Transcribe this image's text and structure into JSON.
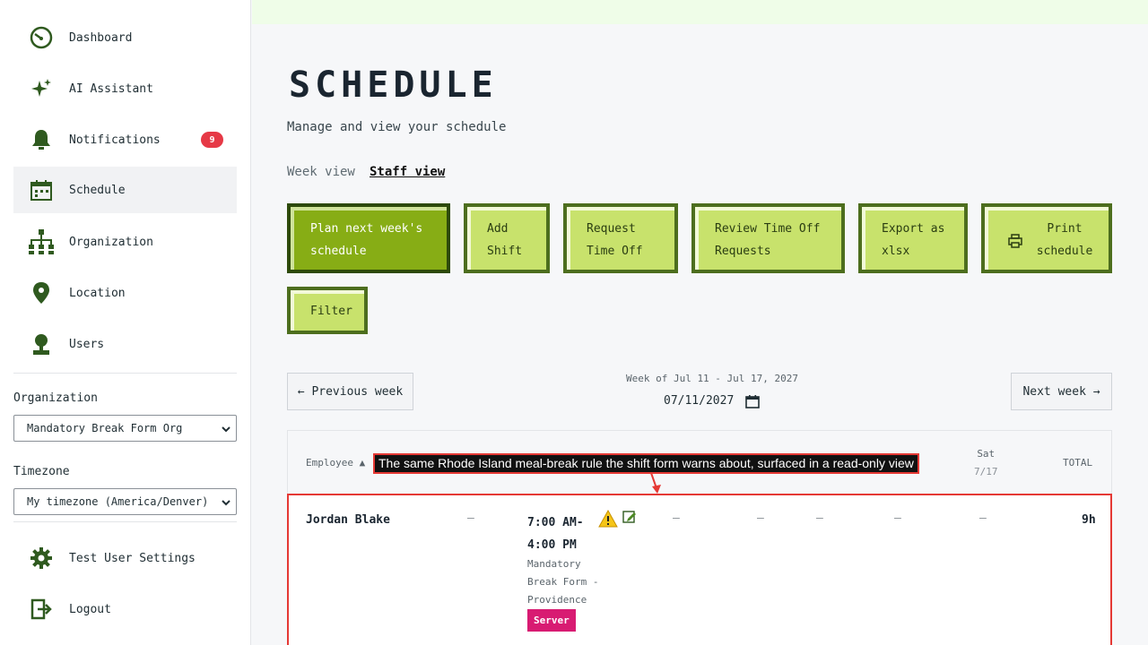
{
  "sidebar": {
    "nav": [
      {
        "label": "Dashboard",
        "icon": "dashboard-gauge-icon"
      },
      {
        "label": "AI Assistant",
        "icon": "sparkle-icon"
      },
      {
        "label": "Notifications",
        "icon": "bell-icon",
        "badge": "9"
      },
      {
        "label": "Schedule",
        "icon": "calendar-icon",
        "active": true
      },
      {
        "label": "Organization",
        "icon": "org-chart-icon"
      },
      {
        "label": "Location",
        "icon": "location-pin-icon"
      },
      {
        "label": "Users",
        "icon": "user-icon"
      }
    ],
    "organization_label": "Organization",
    "organization_value": "Mandatory Break Form Org",
    "timezone_label": "Timezone",
    "timezone_value": "My timezone (America/Denver)",
    "settings_label": "Test User Settings",
    "logout_label": "Logout"
  },
  "main": {
    "title": "SCHEDULE",
    "subtitle": "Manage and view your schedule",
    "tabs": {
      "week": "Week view",
      "staff": "Staff view"
    },
    "actions": {
      "plan": [
        "Plan next week's",
        "schedule"
      ],
      "add_shift": [
        "Add",
        "Shift"
      ],
      "request_time_off": [
        "Request",
        "Time Off"
      ],
      "review_time_off": [
        "Review Time Off",
        "Requests"
      ],
      "export": [
        "Export as",
        "xlsx"
      ],
      "print": [
        "Print",
        "schedule"
      ],
      "filter": "Filter"
    },
    "week_nav": {
      "previous": "← Previous week",
      "next": "Next week →",
      "range": "Week of Jul 11 - Jul 17, 2027",
      "date": "07/11/2027"
    },
    "table": {
      "employee_header": "Employee ▲",
      "saturday_header": "Sat",
      "saturday_date": "7/17",
      "total_header": "TOTAL",
      "row": {
        "employee": "Jordan Blake",
        "shift_start": "7:00 AM-",
        "shift_end": "4:00 PM",
        "location": "Mandatory Break Form - Providence",
        "role": "Server",
        "total": "9h",
        "empty_cell": "–"
      }
    },
    "annotation": "The same Rhode Island meal-break rule the shift form warns about, surfaced in a read-only view"
  },
  "colors": {
    "accent_green": "#87ad15",
    "light_green": "#c8e26c",
    "dark_green": "#4d6e1e",
    "badge_red": "#e63946",
    "role_pink": "#d81b72",
    "highlight_red": "#e53935",
    "topbar": "#effde8"
  }
}
